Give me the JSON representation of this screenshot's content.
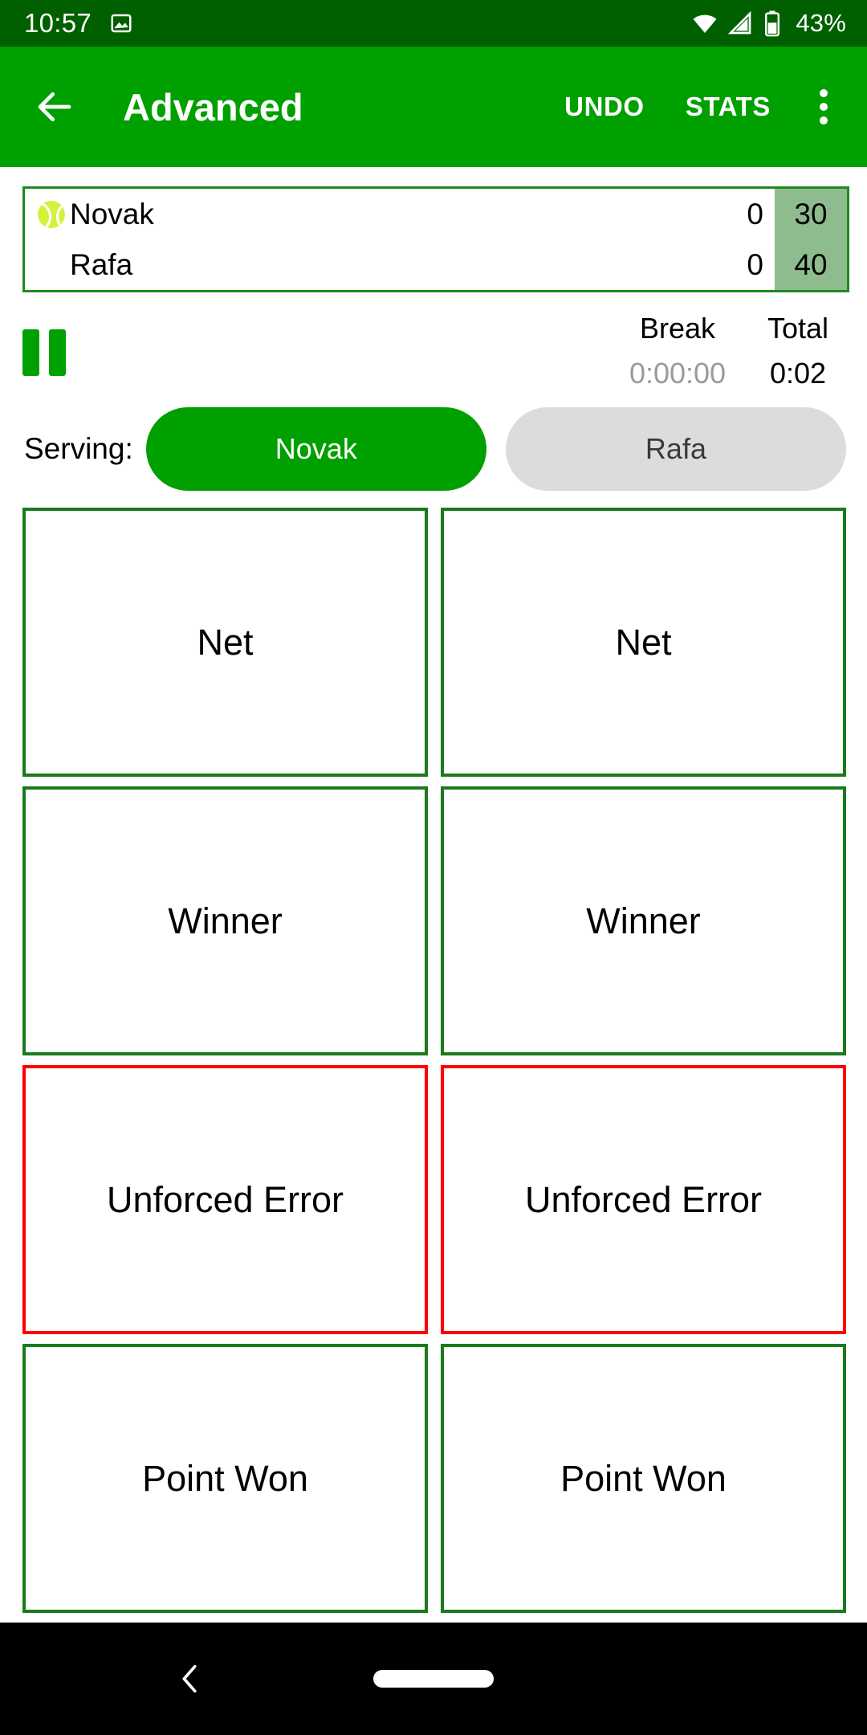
{
  "status_bar": {
    "clock": "10:57",
    "battery_percent": "43%",
    "icons": [
      "image-icon",
      "wifi-icon",
      "cellular-signal-icon",
      "battery-icon"
    ],
    "background_color": "#006000"
  },
  "app_bar": {
    "title": "Advanced",
    "back_icon": "arrow-left-icon",
    "undo_label": "UNDO",
    "stats_label": "STATS",
    "overflow_icon": "more-vertical-icon",
    "background_color": "#00A000"
  },
  "scoreboard": {
    "border_color": "#1F8A1F",
    "points_column_color": "#8FBC8F",
    "ball_color": "#D4F23C",
    "rows": [
      {
        "serving_indicator": "tennis-ball-icon",
        "name": "Novak",
        "games": "0",
        "points": "30"
      },
      {
        "serving_indicator": "",
        "name": "Rafa",
        "games": "0",
        "points": "40"
      }
    ]
  },
  "timer": {
    "pause_icon": "pause-icon",
    "break_label": "Break",
    "total_label": "Total",
    "break_value": "0:00:00",
    "total_value": "0:02",
    "break_value_color": "#9A9A9A",
    "total_value_color": "#000000"
  },
  "serving": {
    "label": "Serving:",
    "options": [
      {
        "label": "Novak",
        "selected": true
      },
      {
        "label": "Rafa",
        "selected": false
      }
    ],
    "selected_color": "#00A000",
    "unselected_color": "#DCDCDC"
  },
  "actions": {
    "green_border_color": "#1B7A1B",
    "red_border_color": "#FF0000",
    "rows": [
      {
        "left": "Net",
        "right": "Net",
        "style": "ok"
      },
      {
        "left": "Winner",
        "right": "Winner",
        "style": "ok"
      },
      {
        "left": "Unforced Error",
        "right": "Unforced Error",
        "style": "err"
      },
      {
        "left": "Point Won",
        "right": "Point Won",
        "style": "ok"
      }
    ]
  },
  "nav_bar": {
    "back_icon": "chevron-left-icon",
    "home_icon": "home-pill-icon",
    "background_color": "#000000"
  }
}
